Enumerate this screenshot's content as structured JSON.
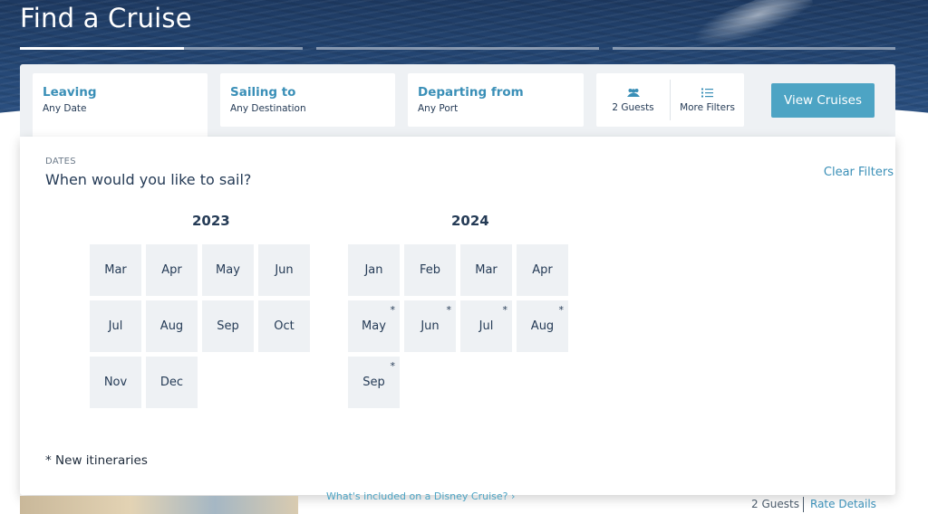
{
  "header": {
    "title": "Find a Cruise"
  },
  "filters": {
    "leaving": {
      "label": "Leaving",
      "value": "Any Date"
    },
    "sailing_to": {
      "label": "Sailing to",
      "value": "Any Destination"
    },
    "departing_from": {
      "label": "Departing from",
      "value": "Any Port"
    },
    "guests": {
      "label": "2 Guests",
      "icon": "guests-icon"
    },
    "more_filters": {
      "label": "More Filters",
      "icon": "list-icon"
    },
    "view_button": "View Cruises"
  },
  "panel": {
    "section_label": "DATES",
    "heading": "When would you like to sail?",
    "clear_filters": "Clear Filters",
    "footnote": "* New itineraries",
    "years": [
      {
        "year": "2023",
        "months": [
          {
            "label": "Mar",
            "new": false
          },
          {
            "label": "Apr",
            "new": false
          },
          {
            "label": "May",
            "new": false
          },
          {
            "label": "Jun",
            "new": false
          },
          {
            "label": "Jul",
            "new": false
          },
          {
            "label": "Aug",
            "new": false
          },
          {
            "label": "Sep",
            "new": false
          },
          {
            "label": "Oct",
            "new": false
          },
          {
            "label": "Nov",
            "new": false
          },
          {
            "label": "Dec",
            "new": false
          }
        ]
      },
      {
        "year": "2024",
        "months": [
          {
            "label": "Jan",
            "new": false
          },
          {
            "label": "Feb",
            "new": false
          },
          {
            "label": "Mar",
            "new": false
          },
          {
            "label": "Apr",
            "new": false
          },
          {
            "label": "May",
            "new": true
          },
          {
            "label": "Jun",
            "new": true
          },
          {
            "label": "Jul",
            "new": true
          },
          {
            "label": "Aug",
            "new": true
          },
          {
            "label": "Sep",
            "new": true
          }
        ]
      }
    ],
    "new_marker": "*"
  },
  "below": {
    "included_link": "What's included on a Disney Cruise? ›",
    "guests": "2 Guests",
    "rate_details": "Rate Details"
  },
  "colors": {
    "accent": "#3a8fb7",
    "button": "#4da4c4",
    "text": "#253b56",
    "tile": "#eef1f4"
  }
}
